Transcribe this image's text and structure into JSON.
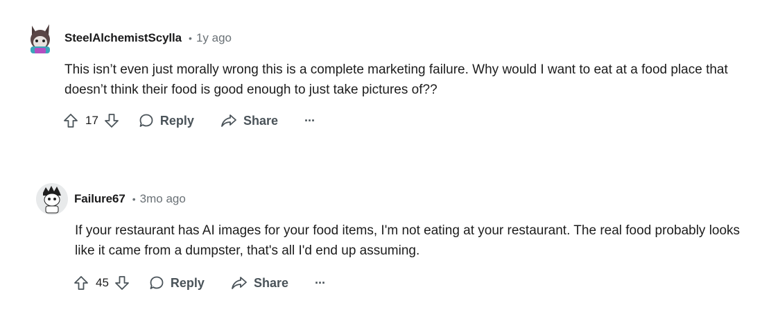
{
  "comments": [
    {
      "username": "SteelAlchemistScylla",
      "separator": "•",
      "time": "1y ago",
      "text": "This isn’t even just morally wrong this is a complete marketing failure. Why would I want to eat at a food place that doesn’t think their food is good enough to just take pictures of??",
      "score": "17",
      "reply_label": "Reply",
      "share_label": "Share",
      "more_label": "···",
      "icons": [
        "upvote-icon",
        "downvote-icon",
        "reply-bubble-icon",
        "share-arrow-icon",
        "more-icon"
      ]
    },
    {
      "username": "Failure67",
      "separator": "•",
      "time": "3mo ago",
      "text": "If your restaurant has AI images for your food items, I'm not eating at your restaurant. The real food probably looks like it came from a dumpster, that's all I'd end up assuming.",
      "score": "45",
      "reply_label": "Reply",
      "share_label": "Share",
      "more_label": "···",
      "icons": [
        "upvote-icon",
        "downvote-icon",
        "reply-bubble-icon",
        "share-arrow-icon",
        "more-icon"
      ]
    }
  ],
  "colors": {
    "text": "#1c1c1c",
    "meta": "#6a7176",
    "action": "#4a5359"
  }
}
